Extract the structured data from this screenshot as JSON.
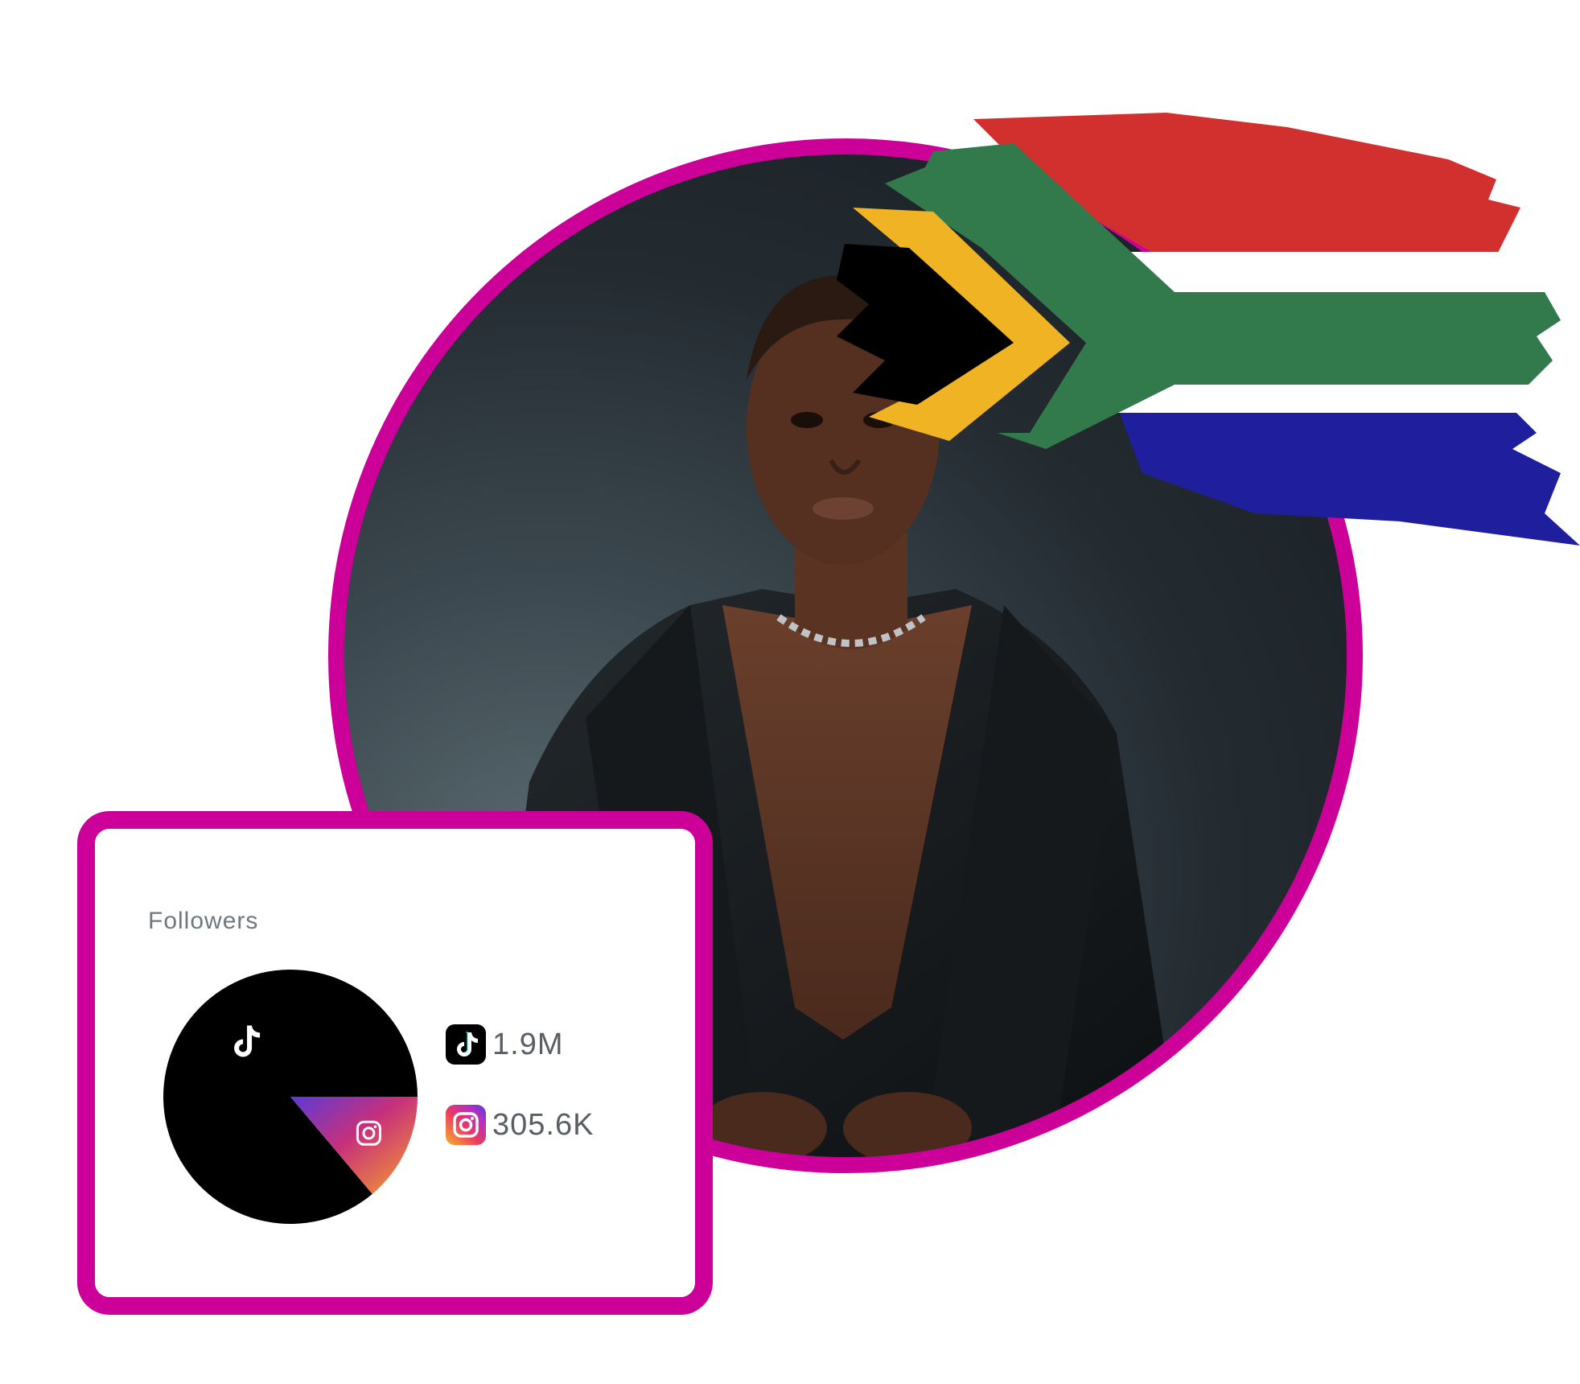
{
  "card": {
    "title": "Followers"
  },
  "chart_data": {
    "type": "pie",
    "categories": [
      "TikTok",
      "Instagram"
    ],
    "values": [
      1900000,
      305600
    ],
    "value_labels": [
      "1.9M",
      "305.6K"
    ],
    "icons": [
      "tiktok-icon",
      "instagram-icon"
    ]
  },
  "legend": [
    {
      "icon": "tiktok-icon",
      "value": "1.9M"
    },
    {
      "icon": "instagram-icon",
      "value": "305.6K"
    }
  ],
  "colors": {
    "accent": "#cc0099",
    "tiktok": "#000000",
    "instagram_gradient": [
      "#f7b32b",
      "#e93a62",
      "#b62fc0",
      "#5b3ad8"
    ],
    "flag": [
      "#d22f2f",
      "#ffffff",
      "#327a4b",
      "#f0b323",
      "#000000",
      "#1f1f9e"
    ]
  }
}
